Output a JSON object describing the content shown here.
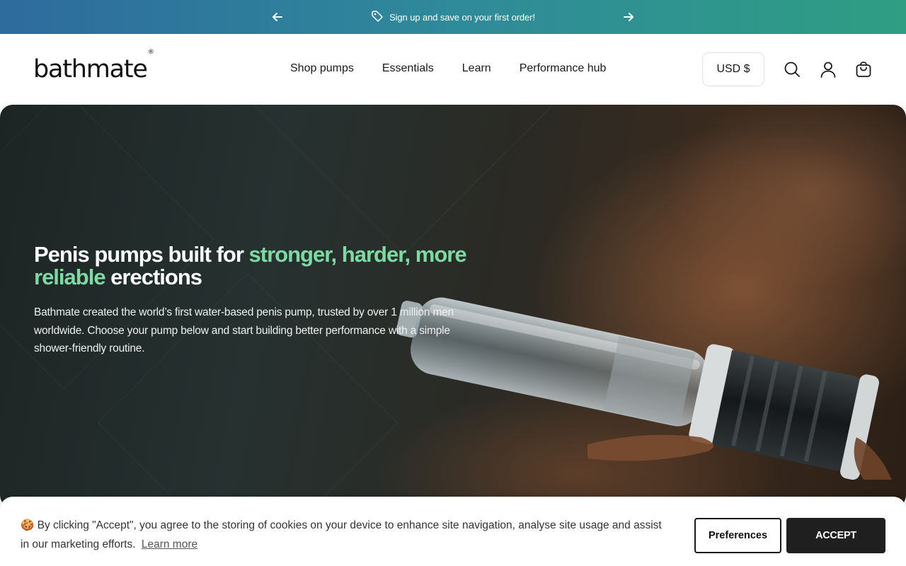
{
  "announcement": {
    "message": "Sign up and save on your first order!",
    "prev_icon": "arrow-left-icon",
    "next_icon": "arrow-right-icon",
    "tag_icon": "tag-icon"
  },
  "header": {
    "logo": "bathmate",
    "logo_mark": "®",
    "nav": [
      {
        "label": "Shop pumps"
      },
      {
        "label": "Essentials"
      },
      {
        "label": "Learn"
      },
      {
        "label": "Performance hub"
      }
    ],
    "currency": "USD $",
    "icons": [
      "search-icon",
      "account-icon",
      "cart-icon"
    ]
  },
  "hero": {
    "title_part1": "Penis pumps built for ",
    "title_accent": "stronger, harder, more reliable",
    "title_part2": " erections",
    "text": "Bathmate created the world’s first water-based penis pump, trusted by over 1 million men worldwide. Choose your pump below and start building better performance with a simple shower-friendly routine."
  },
  "cookie": {
    "emoji": "🍪",
    "text": "By clicking \"Accept\", you agree to the storing of cookies on your device to enhance site navigation, analyse site usage and assist in our marketing efforts.",
    "learn_more": "Learn more",
    "preferences": "Preferences",
    "accept": "ACCEPT"
  },
  "colors": {
    "accent_green": "#7ed9a3",
    "announcement_gradient_start": "#2e6b9e",
    "announcement_gradient_end": "#2f9e83",
    "accept_button": "#1f1f1f"
  }
}
